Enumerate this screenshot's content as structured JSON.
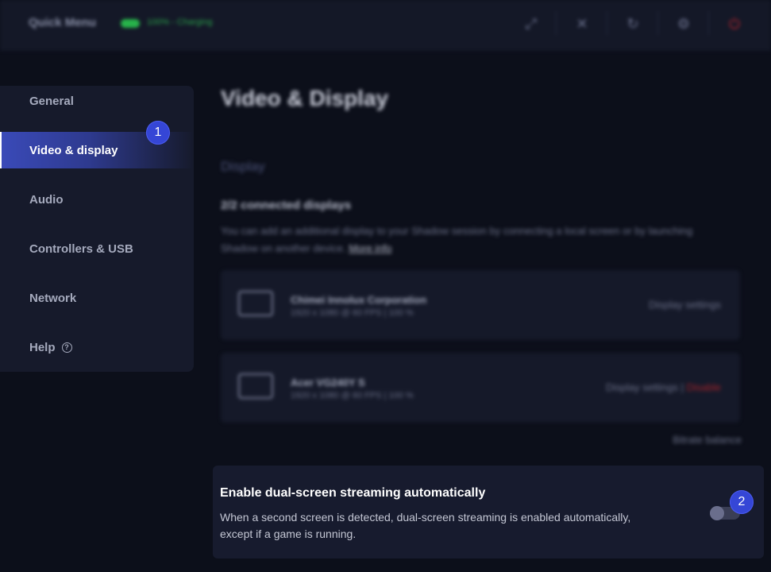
{
  "topbar": {
    "title": "Quick Menu",
    "battery_text": "100% - Charging",
    "icons": [
      "expand-icon",
      "close-stream-icon",
      "refresh-icon",
      "settings-icon",
      "power-icon"
    ]
  },
  "sidebar": {
    "items": [
      {
        "label": "General"
      },
      {
        "label": "Video & display",
        "active": true
      },
      {
        "label": "Audio"
      },
      {
        "label": "Controllers & USB"
      },
      {
        "label": "Network"
      },
      {
        "label": "Help"
      }
    ]
  },
  "badges": {
    "one": "1",
    "two": "2"
  },
  "main": {
    "title": "Video & Display",
    "section": "Display",
    "connected": "2/2 connected displays",
    "desc": "You can add an additional display to your Shadow session by connecting a local screen or by launching Shadow on another device.",
    "more_info": "More info",
    "displays": [
      {
        "name": "Chimei Innolux Corporation",
        "res": "1920 x 1080 @ 60 FPS  |  100 %",
        "settings": "Display settings"
      },
      {
        "name": "Acer VG240Y S",
        "res": "1920 x 1080 @ 60 FPS  |  100 %",
        "settings": "Display settings",
        "disable": "Disable"
      }
    ],
    "bitrate": "Bitrate balance"
  },
  "setting": {
    "title": "Enable dual-screen streaming automatically",
    "desc": "When a second screen is detected, dual-screen streaming is enabled automatically, except if a game is running.",
    "enabled": false
  },
  "colors": {
    "accent": "#3546d6",
    "power": "#b3232b",
    "battery": "#27b34a"
  }
}
